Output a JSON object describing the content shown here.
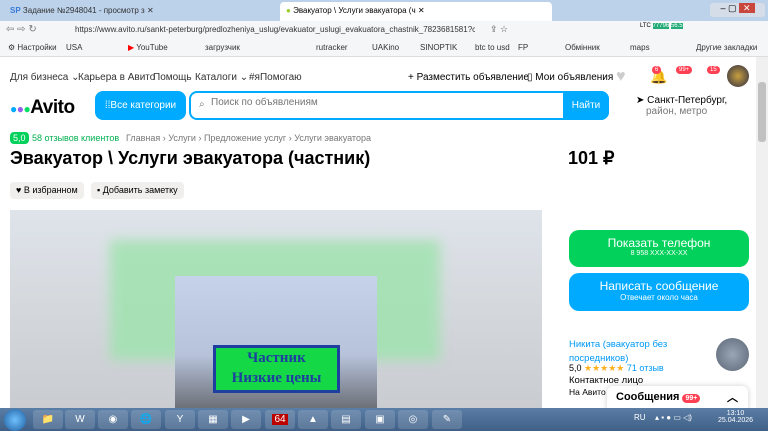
{
  "browser": {
    "tabs": [
      {
        "label": "Задание №2948041 - просмотр з"
      },
      {
        "label": "Эвакуатор \\ Услуги эвакуатора (ч"
      }
    ],
    "url": "https://www.avito.ru/sankt-peterburg/predlozheniya_uslug/evakuator_uslugi_evakuatora_chastnik_7823681581?context=H4sIA...",
    "bookmarks": [
      "Настройки",
      "USA",
      "YouTube",
      "загрузчик",
      "rutracker",
      "UAKino",
      "SINOPTIK",
      "btc to usd",
      "FP",
      "Обмінник",
      "maps"
    ],
    "other_bookmarks": "Другие закладки",
    "ext_badges": {
      "ltc": "LTC",
      "price1": "77796",
      "price2": "56.5"
    }
  },
  "topnav": {
    "links": [
      "Для бизнеса",
      "Карьера в Авито",
      "Помощь",
      "Каталоги",
      "#яПомогаю"
    ],
    "post_ad": "Разместить объявление",
    "my_ads": "Мои объявления",
    "badges": {
      "notifications": "6",
      "messages": "99+",
      "cart": "15"
    }
  },
  "header": {
    "logo": "Avito",
    "categories": "Все категории",
    "search_placeholder": "Поиск по объявлениям",
    "search_button": "Найти",
    "city": "Санкт-Петербург,",
    "district": "район, метро"
  },
  "listing": {
    "rating": "5,0",
    "reviews": "58 отзывов клиентов",
    "breadcrumbs": [
      "Главная",
      "Услуги",
      "Предложение услуг",
      "Услуги эвакуатора"
    ],
    "title": "Эвакуатор \\ Услуги эвакуатора (частник)",
    "price": "101 ₽",
    "favorite": "В избранном",
    "note": "Добавить заметку",
    "sign_line1": "Частник",
    "sign_line2": "Низкие цены"
  },
  "sidebar": {
    "show_phone": "Показать телефон",
    "phone": "8 958 XXX-XX-XX",
    "write": "Написать сообщение",
    "reply_time": "Отвечает около часа",
    "seller_name": "Никита (эвакуатор без посредников)",
    "seller_rating": "5,0",
    "stars": 5,
    "seller_reviews": "71 отзыв",
    "contact": "Контактное лицо",
    "on_avito": "На Авито с"
  },
  "messages_popup": {
    "label": "Сообщения",
    "badge": "99+"
  },
  "taskbar": {
    "lang": "RU",
    "time": "13:10",
    "date": "25.04.2026",
    "app64": "64"
  },
  "colors": {
    "green": "#02d15c",
    "blue": "#00aaff",
    "link": "#0099f7"
  }
}
